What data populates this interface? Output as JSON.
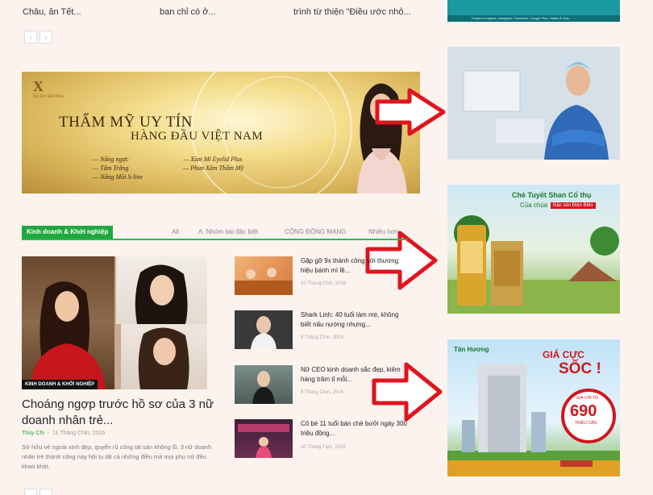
{
  "top_headlines": [
    "Châu, ăn Tết...",
    "ban chỉ có ở...",
    "trình từ thiện \"Điều ước nhỏ..."
  ],
  "banner": {
    "brand": "XUÂN HƯƠNG",
    "headline_line1": "THẨM MỸ UY TÍN",
    "headline_line2": "HÀNG ĐẦU VIỆT NAM",
    "services_left": [
      "Nâng ngực",
      "Tắm Trắng",
      "Nâng Mũi S-line"
    ],
    "services_right": [
      "Xăm Mí Eyelid Plus",
      "Phun Xăm Thẩm Mỹ"
    ]
  },
  "category": {
    "badge": "Kinh doanh & Khởi nghiệp",
    "tabs": [
      "All",
      "A. Nhóm bài đặc biệt",
      "CỘNG ĐỒNG MẠNG",
      "Nhiều hơn"
    ]
  },
  "main_story": {
    "tag": "KINH DOANH & KHỞI NGHIỆP",
    "title": "Choáng ngợp trước hồ sơ của 3 nữ doanh nhân trẻ...",
    "author": "Thủy Chi",
    "date": "11 Tháng Chín, 2016",
    "excerpt": "Sở hữu vẻ ngoài xinh đẹp, quyến rũ cũng tài sản không lồ, 3 nữ doanh nhân trẻ thành công này hội tụ tất cả những điều mà mọi phụ nữ đều khao khát."
  },
  "side_items": [
    {
      "title": "Gặp gỡ 9x thành công với thương hiệu bánh mì lề...",
      "date": "10 Tháng Chín, 2016"
    },
    {
      "title": "Shark Linh: 40 tuổi làm mẹ, không biết nấu nướng nhưng...",
      "date": "9 Tháng Chín, 2016"
    },
    {
      "title": "Nữ CEO kinh doanh sắc đẹp, kiếm hàng trăm tỉ mỗi...",
      "date": "8 Tháng Chín, 2016"
    },
    {
      "title": "Cô bé 11 tuổi bán chè bưởi ngày 300 triệu đồng...",
      "date": "30 Tháng Tám, 2016"
    }
  ],
  "ads": {
    "top_strip": "Posted in subject, Instagram, Facebook, Google Plus, Twitter & Zalo",
    "tea_title_1": "Chè Tuyết Shan Cổ thụ",
    "tea_title_2": "Của chúa",
    "tea_badge": "Đặc sản Điện Biên",
    "apt_logo": "Tân Hương",
    "apt_headline_1": "GIÁ CỰC",
    "apt_headline_2": "SỐC !",
    "apt_price_label": "GIÁ CHỈ TỪ",
    "apt_price": "690",
    "apt_price_unit": "TRIỆU CĂN"
  },
  "colors": {
    "accent_green": "#1fa83f",
    "arrow_red": "#e0141e",
    "background": "#fdf3ee"
  }
}
